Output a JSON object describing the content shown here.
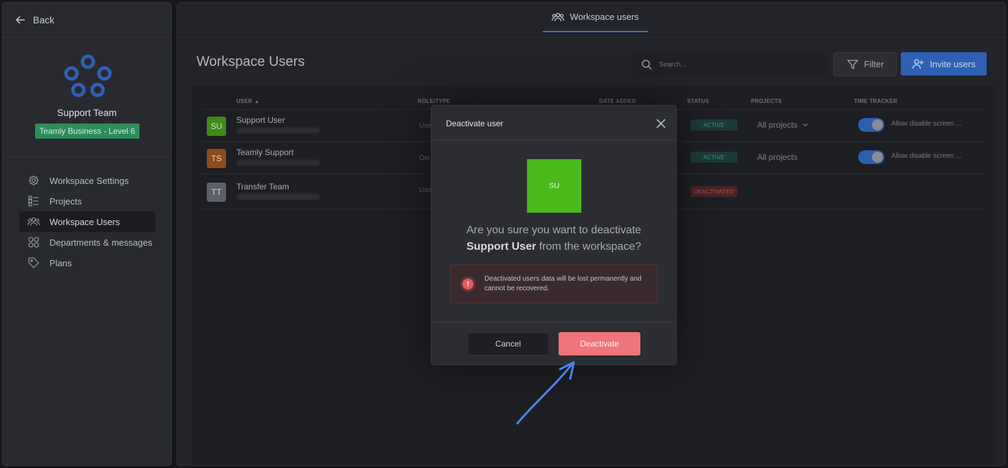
{
  "sidebar": {
    "back_label": "Back",
    "team_name": "Support Team",
    "plan_badge": "Teamly Business - Level 6",
    "nav": [
      {
        "label": "Workspace Settings",
        "icon": "gear-icon"
      },
      {
        "label": "Projects",
        "icon": "list-icon"
      },
      {
        "label": "Workspace Users",
        "icon": "users-icon"
      },
      {
        "label": "Departments & messages",
        "icon": "grid-icon"
      },
      {
        "label": "Plans",
        "icon": "tag-icon"
      }
    ]
  },
  "header": {
    "tab_label": "Workspace users",
    "page_title": "Workspace Users",
    "search_placeholder": "Search...",
    "filter_label": "Filter",
    "invite_label": "Invite users"
  },
  "table": {
    "columns": [
      "USER",
      "ROLE/TYPE",
      "DATE ADDED",
      "STATUS",
      "PROJECTS",
      "TIME TRACKER"
    ],
    "rows": [
      {
        "initials": "SU",
        "name": "Support User",
        "role": "Use",
        "status": "ACTIVE",
        "projects": "All projects",
        "tracker_label": "Allow disable screen ...",
        "avatar_color": "#3e8b18"
      },
      {
        "initials": "TS",
        "name": "Teamly Support",
        "role": "Ow",
        "status": "ACTIVE",
        "projects": "All projects",
        "tracker_label": "Allow disable screen ...",
        "avatar_color": "#8d4a1a"
      },
      {
        "initials": "TT",
        "name": "Transfer Team",
        "role": "Use",
        "status": "DEACTIVATED",
        "projects": "",
        "tracker_label": "",
        "avatar_color": "#5d6068"
      }
    ]
  },
  "modal": {
    "title": "Deactivate user",
    "avatar_initials": "SU",
    "question_prefix": "Are you sure you want to deactivate",
    "user_name": "Support User",
    "question_suffix": "from the workspace?",
    "warning": "Deactivated users data will be lost permanently and cannot be recovered.",
    "cancel_label": "Cancel",
    "deactivate_label": "Deactivate"
  },
  "colors": {
    "accent_blue": "#2f60b4",
    "danger": "#f0747a",
    "avatar_green": "#4ab91b"
  }
}
